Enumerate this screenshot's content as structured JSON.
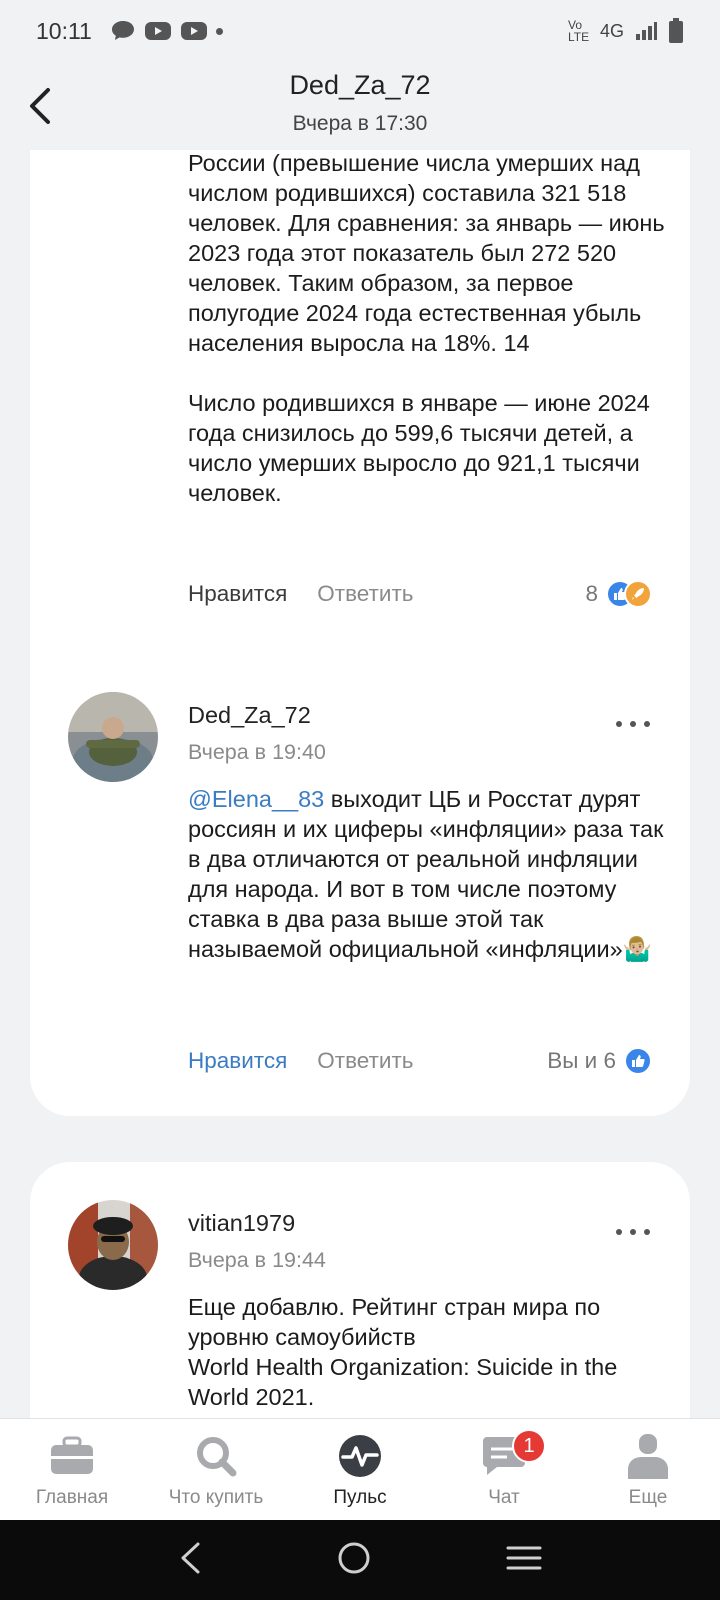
{
  "status_bar": {
    "time": "10:11",
    "network_label": "4G",
    "volte_label": "Vo LTE"
  },
  "header": {
    "title": "Ded_Za_72",
    "subtitle": "Вчера в 17:30"
  },
  "posts": [
    {
      "text": "России (превышение числа умерших над числом родившихся) составила 321 518 человек. Для сравнения: за январь — июнь 2023 года этот показатель был 272 520 человек. Таким образом, за первое полугодие 2024 года естественная убыль населения выросла на 18%. 14\n\nЧисло родившихся в январе — июне 2024 года снизилось до 599,6 тысячи детей, а число умерших выросло до 921,1 тысячи человек.",
      "like_label": "Нравится",
      "reply_label": "Ответить",
      "likes_count": "8",
      "reactions": [
        "thumbs-up",
        "rocket"
      ]
    },
    {
      "author": "Ded_Za_72",
      "time": "Вчера в 19:40",
      "mention": "@Elena__83",
      "text": " выходит ЦБ и Росстат дурят россиян и их циферы «инфляции» раза так в два отличаются от реальной инфляции для народа. И вот в том числе поэтому ставка в два раза выше этой так называемой официальной «инфляции»🤷🏼‍♂️",
      "like_label": "Нравится",
      "reply_label": "Ответить",
      "likes_count": "Вы и 6",
      "liked": true,
      "reactions": [
        "thumbs-up"
      ]
    },
    {
      "author": "vitian1979",
      "time": "Вчера в 19:44",
      "text": "Еще добавлю. Рейтинг стран мира по уровню самоубийств\nWorld Health Organization: Suicide in the World 2021."
    }
  ],
  "tabbar": {
    "tabs": [
      {
        "label": "Главная",
        "icon": "briefcase-icon"
      },
      {
        "label": "Что купить",
        "icon": "search-icon"
      },
      {
        "label": "Пульс",
        "icon": "pulse-icon",
        "active": true
      },
      {
        "label": "Чат",
        "icon": "chat-icon",
        "badge": "1"
      },
      {
        "label": "Еще",
        "icon": "profile-icon"
      }
    ]
  },
  "colors": {
    "accent": "#3a7cc2",
    "background": "#f1f2f4",
    "badge": "#e53935"
  }
}
